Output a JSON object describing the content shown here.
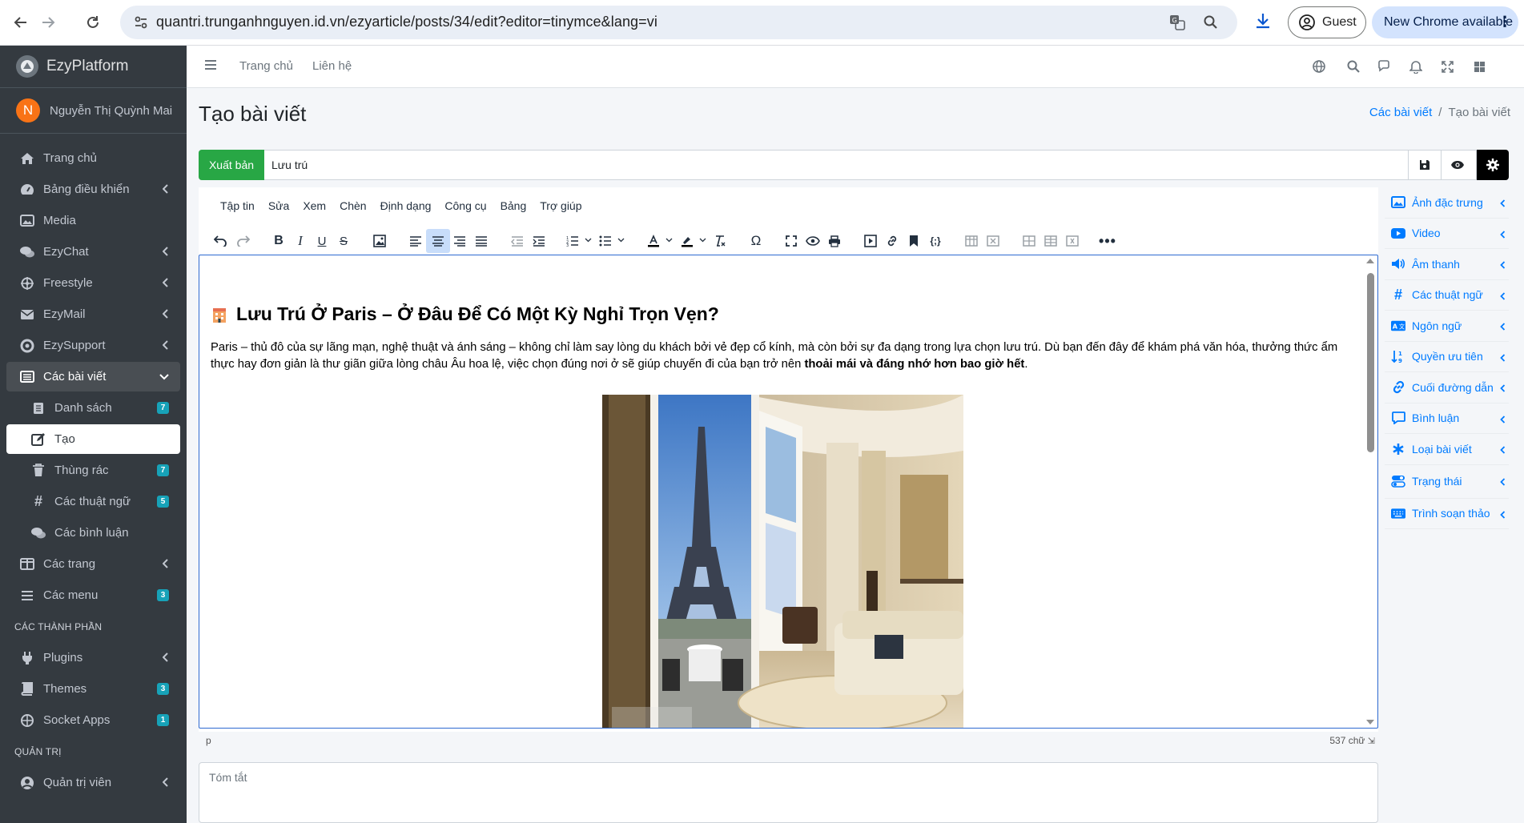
{
  "browser": {
    "url": "quantri.trunganhnguyen.id.vn/ezyarticle/posts/34/edit?editor=tinymce&lang=vi",
    "profile_label": "Guest",
    "update_label": "New Chrome available"
  },
  "sidebar": {
    "brand": "EzyPlatform",
    "user_initial": "N",
    "user_name": "Nguyễn Thị Quỳnh Mai",
    "items": [
      {
        "label": "Trang chủ",
        "icon": "home-icon"
      },
      {
        "label": "Bảng điều khiển",
        "icon": "dashboard-icon"
      },
      {
        "label": "Media",
        "icon": "image-icon"
      },
      {
        "label": "EzyChat",
        "icon": "comments-icon"
      },
      {
        "label": "Freestyle",
        "icon": "dharmachakra-icon"
      },
      {
        "label": "EzyMail",
        "icon": "mail-icon"
      },
      {
        "label": "EzySupport",
        "icon": "support-icon"
      },
      {
        "label": "Các bài viết",
        "icon": "list-icon"
      },
      {
        "label": "Danh sách",
        "icon": "document-icon",
        "badge": "7"
      },
      {
        "label": "Tạo",
        "icon": "edit-icon"
      },
      {
        "label": "Thùng rác",
        "icon": "trash-icon",
        "badge": "7"
      },
      {
        "label": "Các thuật ngữ",
        "icon": "hashtag-icon",
        "badge": "5"
      },
      {
        "label": "Các bình luận",
        "icon": "comments-icon"
      },
      {
        "label": "Các trang",
        "icon": "columns-icon"
      },
      {
        "label": "Các menu",
        "icon": "bars-icon",
        "badge": "3"
      },
      {
        "label": "Plugins",
        "icon": "plug-icon"
      },
      {
        "label": "Themes",
        "icon": "book-icon",
        "badge": "3"
      },
      {
        "label": "Socket Apps",
        "icon": "puzzle-icon",
        "badge": "1"
      },
      {
        "label": "Quản trị viên",
        "icon": "user-circle-icon"
      }
    ],
    "headers": [
      "CÁC THÀNH PHẦN",
      "QUẢN TRỊ"
    ]
  },
  "topbar": {
    "links": [
      "Trang chủ",
      "Liên hệ"
    ]
  },
  "page": {
    "title": "Tạo bài viết",
    "breadcrumb_parent": "Các bài viết",
    "breadcrumb_sep": "/",
    "breadcrumb_current": "Tạo bài viết",
    "publish_label": "Xuất bản",
    "post_title_value": "Lưu trú"
  },
  "editor": {
    "menu": [
      "Tập tin",
      "Sửa",
      "Xem",
      "Chèn",
      "Định dạng",
      "Công cụ",
      "Bảng",
      "Trợ giúp"
    ],
    "heading": "Lưu Trú Ở Paris – Ở Đâu Để Có Một Kỳ Nghỉ Trọn Vẹn?",
    "paragraph_plain": "Paris – thủ đô của sự lãng mạn, nghệ thuật và ánh sáng – không chỉ làm say lòng du khách bởi vẻ đẹp cổ kính, mà còn bởi sự đa dạng trong lựa chọn lưu trú. Dù bạn đến đây để khám phá văn hóa, thưởng thức ẩm thực hay đơn giản là thư giãn giữa lòng châu Âu hoa lệ, việc chọn đúng nơi ở sẽ giúp chuyến đi của bạn trở nên ",
    "paragraph_bold": "thoải mái và đáng nhớ hơn bao giờ hết",
    "paragraph_end": ".",
    "status_element": "p",
    "word_count": "537 chữ"
  },
  "summary_placeholder": "Tóm tắt",
  "right_panel": [
    {
      "label": "Ảnh đặc trưng",
      "icon": "image-icon"
    },
    {
      "label": "Video",
      "icon": "youtube-icon"
    },
    {
      "label": "Âm thanh",
      "icon": "volume-icon"
    },
    {
      "label": "Các thuật ngữ",
      "icon": "hashtag-icon"
    },
    {
      "label": "Ngôn ngữ",
      "icon": "language-icon"
    },
    {
      "label": "Quyền ưu tiên",
      "icon": "sort-numeric-icon"
    },
    {
      "label": "Cuối đường dẫn",
      "icon": "link-icon"
    },
    {
      "label": "Bình luận",
      "icon": "comment-icon"
    },
    {
      "label": "Loại bài viết",
      "icon": "asterisk-icon"
    },
    {
      "label": "Trạng thái",
      "icon": "toggle-icon"
    },
    {
      "label": "Trình soạn thảo",
      "icon": "keyboard-icon"
    }
  ],
  "colors": {
    "sidebar_bg": "#343a40",
    "publish_green": "#28a745",
    "link_blue": "#007bff",
    "badge_teal": "#17a2b8"
  }
}
